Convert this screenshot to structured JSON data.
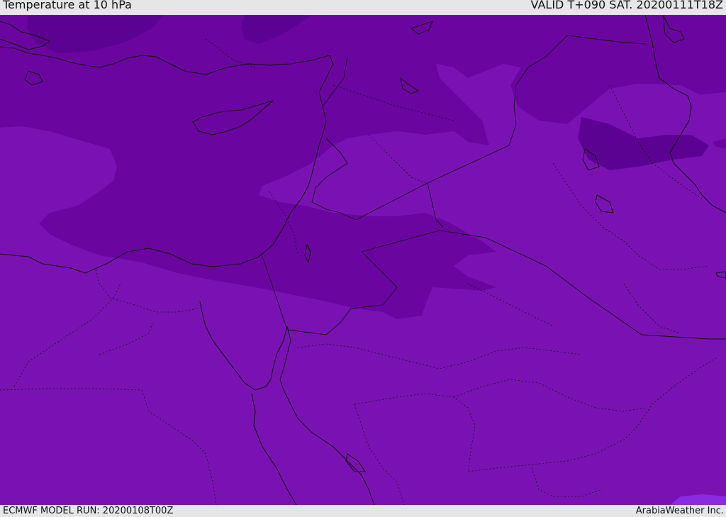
{
  "header": {
    "title": "Temperature at 10 hPa",
    "valid_time": "VALID T+090 SAT. 20200111T18Z"
  },
  "footer": {
    "model_run": "ECMWF MODEL RUN: 20200108T00Z",
    "credit": "ArabiaWeather Inc."
  },
  "colors": {
    "base_purple": "#7a12b3",
    "mid_purple": "#6a059f",
    "dark_purple": "#5c0292",
    "accent_violet": "#8a2be2"
  }
}
